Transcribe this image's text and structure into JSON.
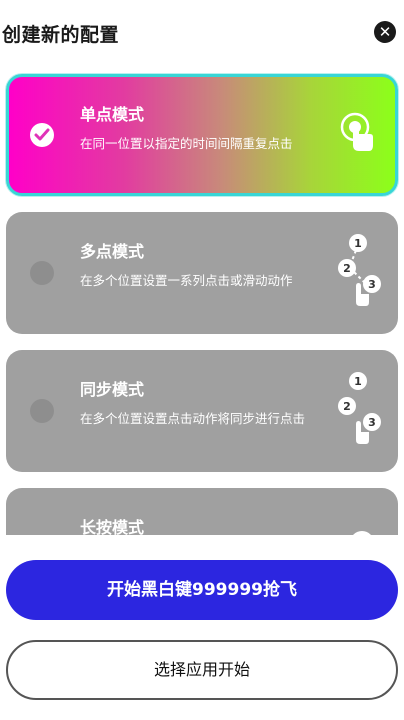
{
  "header": {
    "title": "创建新的配置",
    "close_icon": "close-icon"
  },
  "modes": [
    {
      "title": "单点模式",
      "desc": "在同一位置以指定的时间间隔重复点击",
      "selected": true,
      "icon": "single-tap-icon"
    },
    {
      "title": "多点模式",
      "desc": "在多个位置设置一系列点击或滑动动作",
      "selected": false,
      "icon": "multi-tap-icon",
      "icon_numbers": [
        "1",
        "2",
        "3"
      ]
    },
    {
      "title": "同步模式",
      "desc": "在多个位置设置点击动作将同步进行点击",
      "selected": false,
      "icon": "sync-tap-icon",
      "icon_numbers": [
        "1",
        "2",
        "3"
      ]
    },
    {
      "title": "长按模式",
      "desc": "",
      "selected": false,
      "icon": "long-press-icon"
    }
  ],
  "buttons": {
    "primary_label": "开始黑白键999999抢飞",
    "secondary_label": "选择应用开始"
  },
  "colors": {
    "primary_button": "#2c26e0",
    "card_gray": "#a0a0a0",
    "selected_border": "#38d6d6",
    "gradient_start": "#ff00c8",
    "gradient_end": "#8cff1a"
  }
}
